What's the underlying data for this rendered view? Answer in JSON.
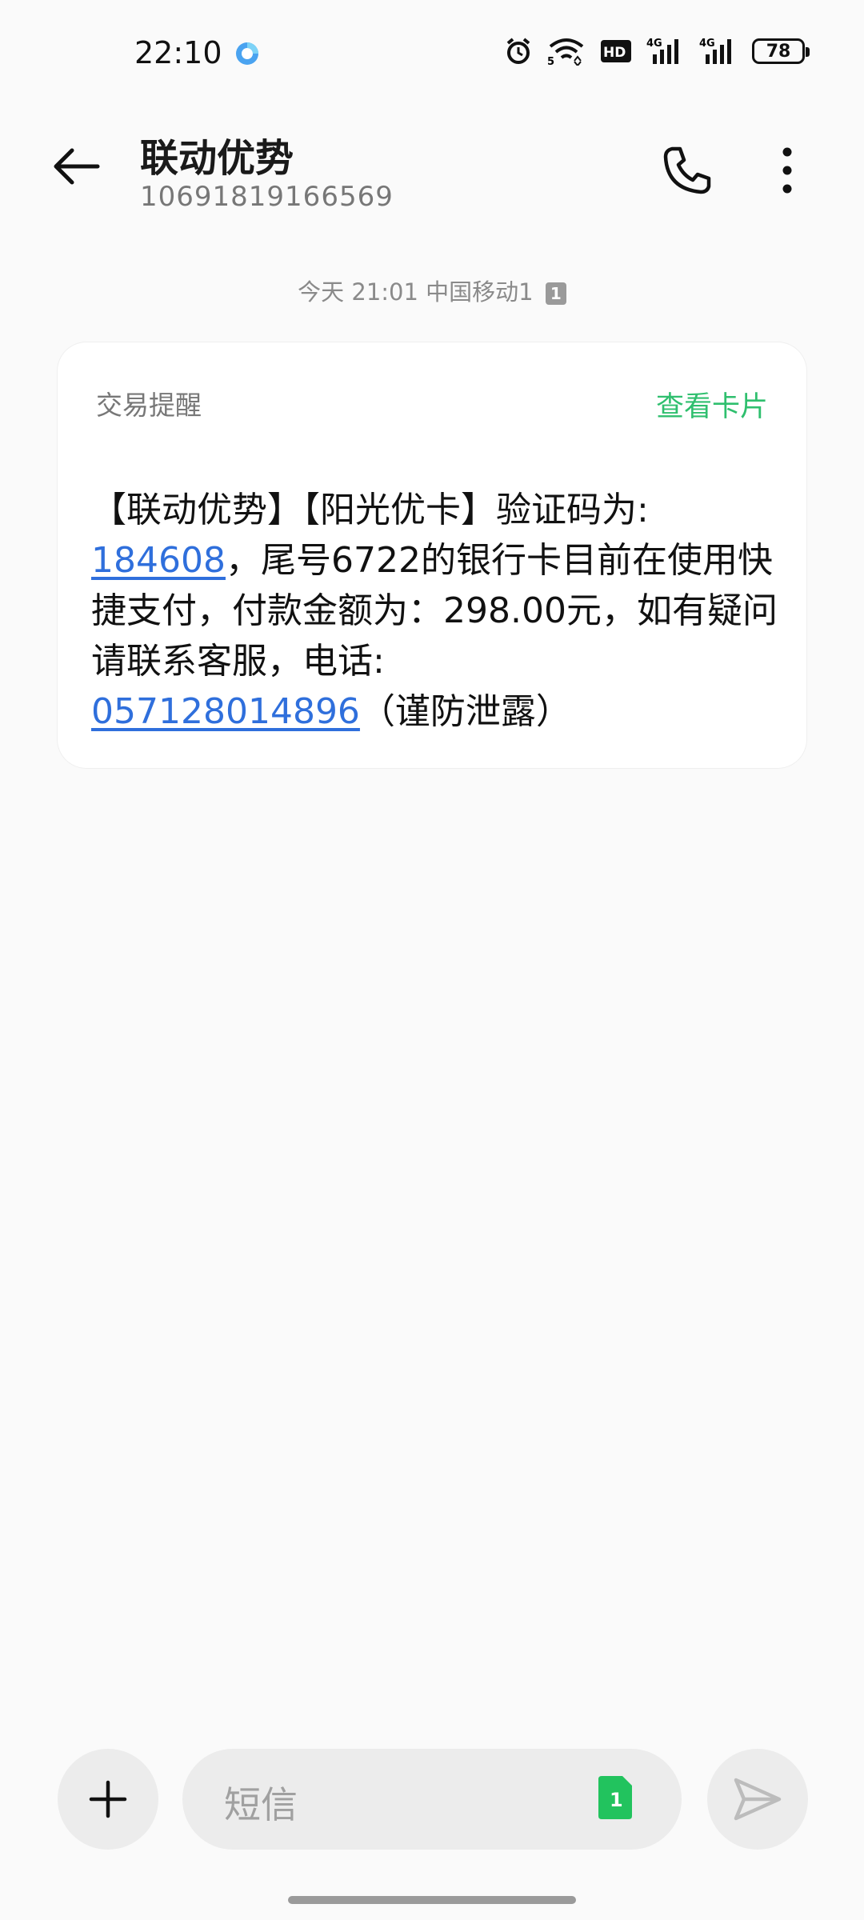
{
  "status_bar": {
    "time": "22:10",
    "battery": "78",
    "icons": [
      "app-notification-icon",
      "alarm-icon",
      "wifi-icon",
      "hd-icon",
      "signal-4g-icon",
      "signal-4g-icon",
      "battery-icon"
    ]
  },
  "header": {
    "contact_name": "联动优势",
    "contact_number": "10691819166569"
  },
  "thread": {
    "timestamp": "今天 21:01  中国移动1",
    "sim_badge": "1"
  },
  "card": {
    "type_label": "交易提醒",
    "view_card_label": "查看卡片",
    "body": {
      "part1": "【联动优势】【阳光优卡】验证码为:",
      "code": "184608",
      "part2": "，尾号6722的银行卡目前在使用快捷支付，付款金额为：298.00元，如有疑问请联系客服，电话:",
      "phone": "057128014896",
      "part3": "（谨防泄露）"
    }
  },
  "composer": {
    "placeholder": "短信",
    "sim_label": "1"
  },
  "colors": {
    "accent_green": "#2fbf6e",
    "link_blue": "#2f6fdc",
    "sim_green": "#22c35e"
  }
}
